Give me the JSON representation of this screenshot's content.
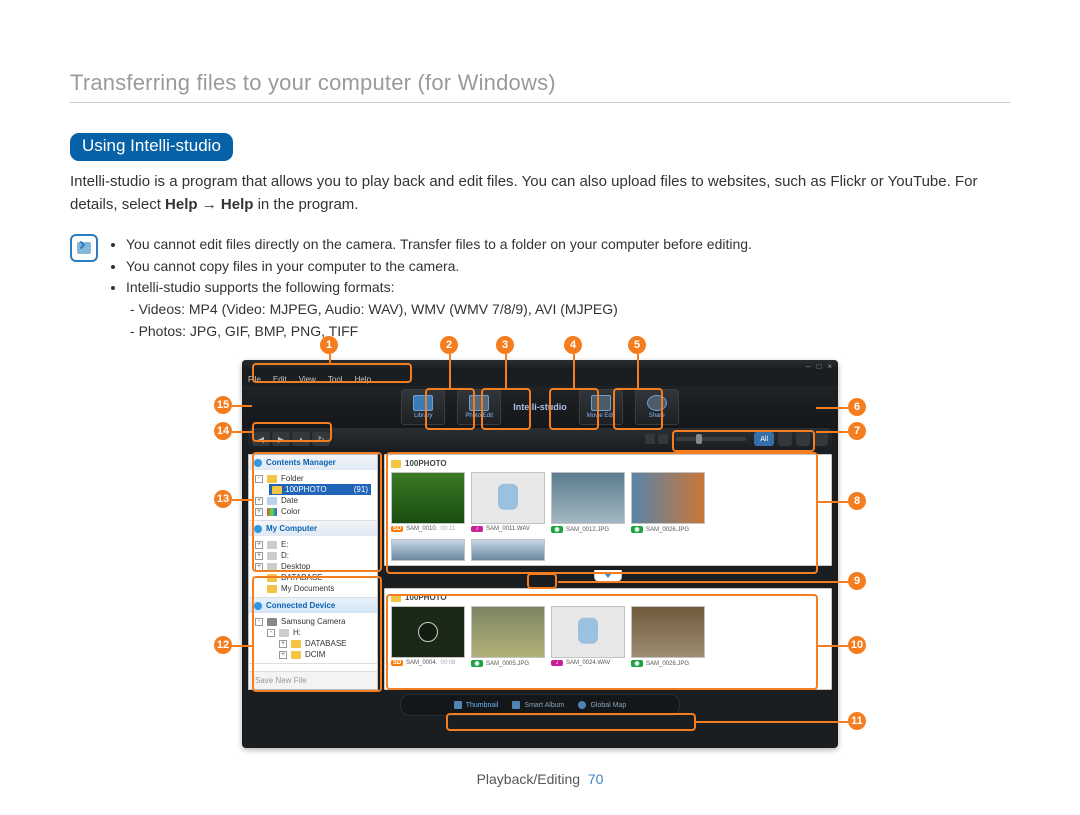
{
  "header": {
    "title": "Transferring files to your computer (for Windows)"
  },
  "section": {
    "badge": "Using Intelli-studio"
  },
  "intro": {
    "text_a": "Intelli-studio is a program that allows you to play back and edit files. You can also upload files to websites, such as Flickr or YouTube. For details, select ",
    "help1": "Help",
    "arrow": " → ",
    "help2": "Help",
    "text_b": " in the program."
  },
  "notes": {
    "items": [
      "You cannot edit files directly on the camera. Transfer files to a folder on your computer before editing.",
      "You cannot copy files in your computer to the camera.",
      "Intelli-studio supports the following formats:"
    ],
    "sub": [
      "Videos: MP4 (Video: MJPEG, Audio: WAV), WMV (WMV 7/8/9), AVI (MJPEG)",
      "Photos: JPG, GIF, BMP, PNG, TIFF"
    ]
  },
  "app": {
    "menus": [
      "File",
      "Edit",
      "View",
      "Tool",
      "Help"
    ],
    "logo": "Intelli-studio",
    "modes": {
      "library": "Library",
      "photo": "Photo Edit",
      "movie": "Movie Edit",
      "share": "Share"
    },
    "toolbar": {
      "all": "All"
    },
    "sidebar": {
      "contents_title": "Contents Manager",
      "folder_root": "Folder",
      "folder_selected": "100PHOTO",
      "folder_count": "(91)",
      "date": "Date",
      "color": "Color",
      "mycomputer_title": "My Computer",
      "drives": [
        "E:",
        "D:",
        "Desktop",
        "DATABASE",
        "My Documents"
      ],
      "connected_title": "Connected Device",
      "device_root": "Samsung Camera",
      "device_drive": "H:",
      "dev_folders": [
        "DATABASE",
        "DCIM"
      ],
      "save_new": "Save New File"
    },
    "pane_title": "100PHOTO",
    "files_top": [
      {
        "tag": "SD",
        "name": "SAM_0010.",
        "ext": "00:11"
      },
      {
        "tag": "AU",
        "name": "SAM_0011.WAV"
      },
      {
        "tag": "PH",
        "name": "SAM_0012.JPG"
      },
      {
        "tag": "PH",
        "name": "SAM_0026.JPG"
      }
    ],
    "files_bottom": [
      {
        "tag": "SD",
        "name": "SAM_0004.",
        "ext": "00:08"
      },
      {
        "tag": "PH",
        "name": "SAM_0005.JPG"
      },
      {
        "tag": "AU",
        "name": "SAM_0024.WAV"
      },
      {
        "tag": "PH",
        "name": "SAM_0026.JPG"
      }
    ],
    "tabs": {
      "thumb": "Thumbnail",
      "smart": "Smart Album",
      "map": "Global Map"
    }
  },
  "callouts": [
    "1",
    "2",
    "3",
    "4",
    "5",
    "6",
    "7",
    "8",
    "9",
    "10",
    "11",
    "12",
    "13",
    "14",
    "15"
  ],
  "footer": {
    "section": "Playback/Editing",
    "page": "70"
  }
}
